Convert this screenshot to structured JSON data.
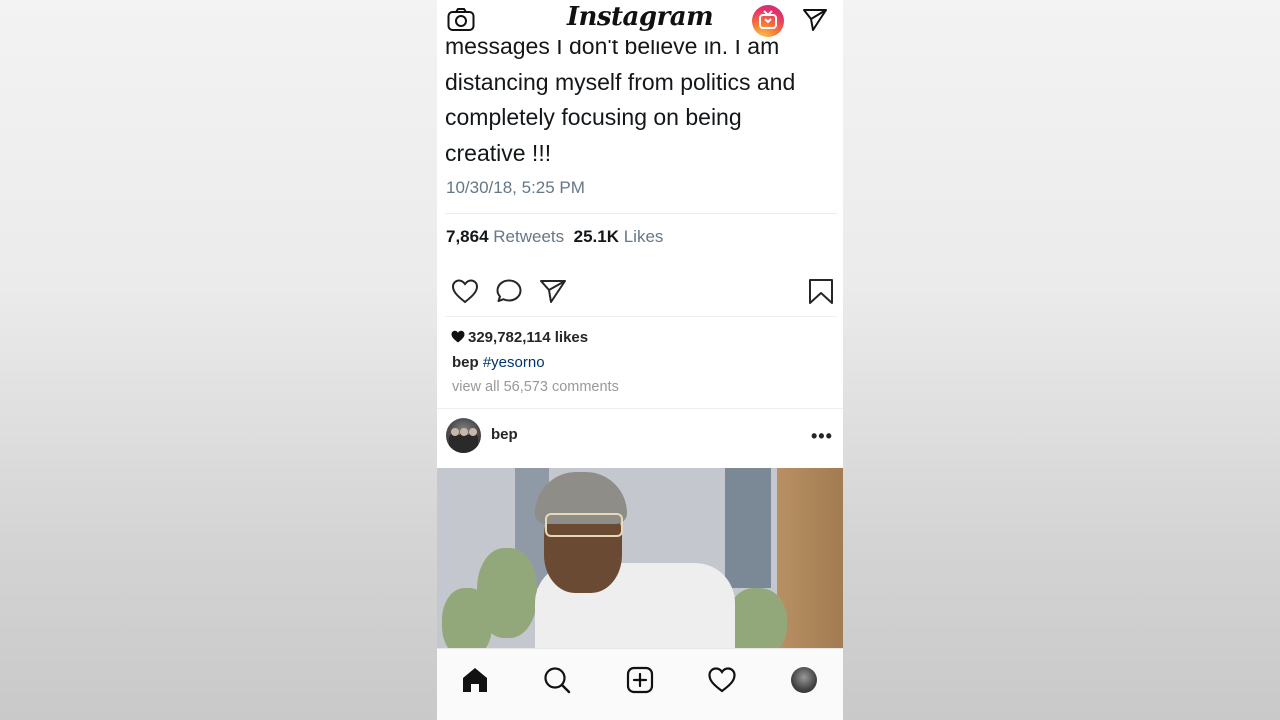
{
  "app": {
    "logo_text": "Instagram"
  },
  "tweet": {
    "text_lines": [
      "messages I don't believe in. I am",
      "distancing myself from politics and",
      "completely focusing on being",
      "creative !!!"
    ],
    "date": "10/30/18, 5:25 PM",
    "retweets_count": "7,864",
    "retweets_label": "Retweets",
    "likes_count": "25.1K",
    "likes_label": "Likes"
  },
  "post": {
    "likes": "329,782,114 likes",
    "caption_user": "bep",
    "caption_tag": "#yesorno",
    "comments_link": "view all 56,573 comments"
  },
  "next_post": {
    "username": "bep",
    "more": "•••"
  },
  "colors": {
    "text": "#262626",
    "hashtag": "#003569",
    "tweet_meta": "#657786",
    "igtv_gradient": [
      "#fdd24a",
      "#f77737",
      "#e1306c",
      "#c13584"
    ]
  },
  "icons": {
    "top_left": "camera-icon",
    "top_igtv": "igtv-icon",
    "top_right": "direct-send-icon",
    "actions": [
      "heart-outline-icon",
      "comment-icon",
      "share-send-icon",
      "bookmark-icon"
    ],
    "bottom_nav": [
      "home-icon",
      "search-icon",
      "add-post-icon",
      "activity-heart-icon",
      "profile-avatar"
    ]
  }
}
